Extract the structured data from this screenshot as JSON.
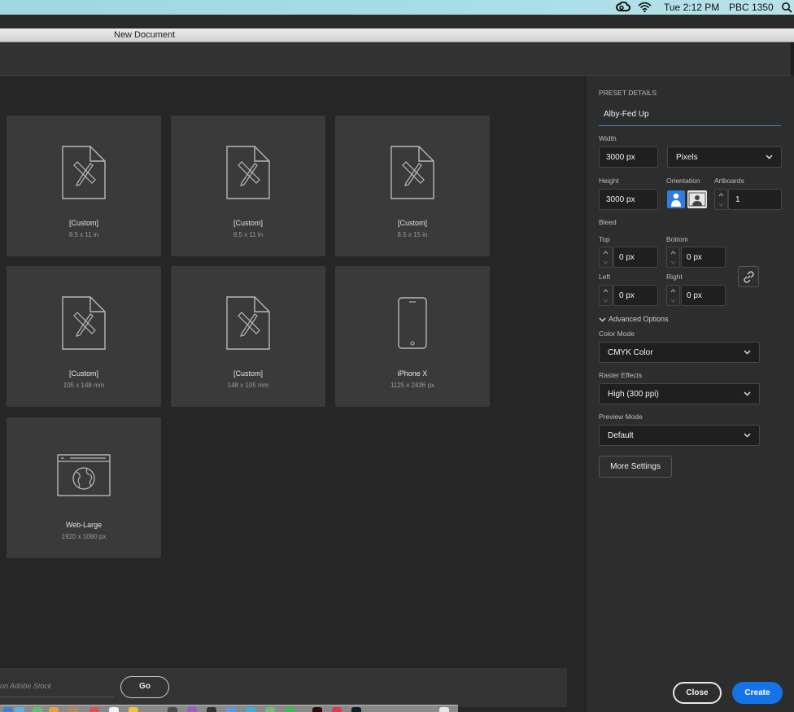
{
  "menubar": {
    "clock": "Tue 2:12 PM",
    "user": "PBC 1350",
    "icons": [
      "creative-cloud-icon",
      "wifi-icon",
      "search-icon"
    ],
    "background": "#a6dde6"
  },
  "window": {
    "title": "New Document"
  },
  "presets": [
    {
      "name": "[Custom]",
      "dims": "8.5 x 11 in",
      "icon": "document-icon"
    },
    {
      "name": "[Custom]",
      "dims": "8.5 x 11 in",
      "icon": "document-icon"
    },
    {
      "name": "[Custom]",
      "dims": "8.5 x 15 in",
      "icon": "document-icon"
    },
    {
      "name": "[Custom]",
      "dims": "105 x 148 mm",
      "icon": "document-icon"
    },
    {
      "name": "[Custom]",
      "dims": "148 x 105 mm",
      "icon": "document-icon"
    },
    {
      "name": "iPhone X",
      "dims": "1125 x 2436 px",
      "icon": "phone-icon"
    },
    {
      "name": "Web-Large",
      "dims": "1920 x 1080 px",
      "icon": "web-icon"
    }
  ],
  "stock": {
    "hint": "on Adobe Stock",
    "go_label": "Go"
  },
  "details": {
    "section_label": "PRESET DETAILS",
    "preset_name": "Alby-Fed Up",
    "width_label": "Width",
    "width_value": "3000 px",
    "units": "Pixels",
    "height_label": "Height",
    "height_value": "3000 px",
    "orientation_label": "Orientation",
    "artboards_label": "Artboards",
    "artboards_value": "1",
    "bleed_label": "Bleed",
    "top_label": "Top",
    "top_value": "0 px",
    "bottom_label": "Bottom",
    "bottom_value": "0 px",
    "left_label": "Left",
    "left_value": "0 px",
    "right_label": "Right",
    "right_value": "0 px",
    "advanced_label": "Advanced Options",
    "color_mode_label": "Color Mode",
    "color_mode_value": "CMYK Color",
    "raster_label": "Raster Effects",
    "raster_value": "High (300 ppi)",
    "preview_label": "Preview Mode",
    "preview_value": "Default",
    "more_settings_label": "More Settings",
    "close_label": "Close",
    "create_label": "Create",
    "accent": "#1473e6"
  }
}
